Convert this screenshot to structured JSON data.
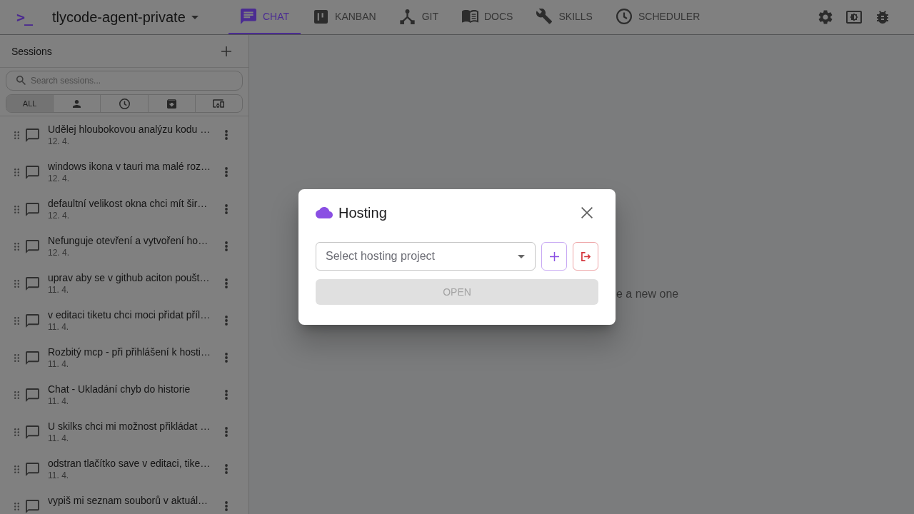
{
  "app": {
    "logo": ">_",
    "project": "tlycode-agent-private"
  },
  "nav_tabs": [
    {
      "label": "CHAT",
      "selected": true
    },
    {
      "label": "KANBAN",
      "selected": false
    },
    {
      "label": "GIT",
      "selected": false
    },
    {
      "label": "DOCS",
      "selected": false
    },
    {
      "label": "SKILLS",
      "selected": false
    },
    {
      "label": "SCHEDULER",
      "selected": false
    }
  ],
  "sessions_panel": {
    "title": "Sessions",
    "search": {
      "placeholder": "Search sessions..."
    },
    "filters": [
      {
        "kind": "text",
        "label": "ALL",
        "selected": true
      },
      {
        "kind": "icon",
        "selected": false
      },
      {
        "kind": "icon",
        "selected": false
      },
      {
        "kind": "icon",
        "selected": false
      },
      {
        "kind": "icon",
        "selected": false
      }
    ]
  },
  "sessions": [
    {
      "title": "Udělej hloubokovou analýzu kodu …",
      "date": "12. 4."
    },
    {
      "title": "windows ikona v tauri ma malé roz…",
      "date": "12. 4."
    },
    {
      "title": "defaultní velikost okna chci mít šir…",
      "date": "12. 4."
    },
    {
      "title": "Nefunguje otevření a vytvoření ho…",
      "date": "12. 4."
    },
    {
      "title": "uprav aby se v github aciton poušt…",
      "date": "11. 4."
    },
    {
      "title": "v editaci tiketu chci moci přidat příl…",
      "date": "11. 4."
    },
    {
      "title": "Rozbitý mcp - při přihlášení k hosti…",
      "date": "11. 4."
    },
    {
      "title": "Chat - Ukladání chyb do historie",
      "date": "11. 4."
    },
    {
      "title": "U skilks chci mi možnost přikládat …",
      "date": "11. 4."
    },
    {
      "title": "odstran tlačítko save v editaci, tike…",
      "date": "11. 4."
    },
    {
      "title": "vypiš mi seznam souborů v aktuál…"
    }
  ],
  "main": {
    "empty_text": "e a new one"
  },
  "dialog": {
    "title": "Hosting",
    "select": {
      "placeholder": "Select hosting project"
    },
    "open_button": {
      "label": "OPEN",
      "disabled": true
    }
  }
}
